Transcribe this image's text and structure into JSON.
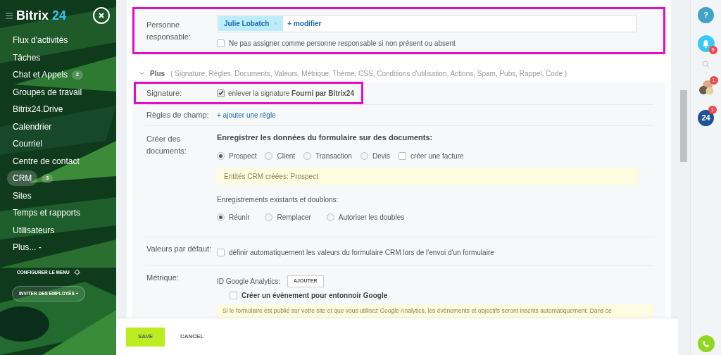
{
  "sidebar": {
    "logo": {
      "name": "Bitrix",
      "number": "24"
    },
    "items": [
      {
        "label": "Flux d'activités",
        "selected": false
      },
      {
        "label": "Tâches",
        "selected": false
      },
      {
        "label": "Chat et Appels",
        "badge": "2",
        "selected": false
      },
      {
        "label": "Groupes de travail",
        "selected": false
      },
      {
        "label": "Bitrix24.Drive",
        "selected": false
      },
      {
        "label": "Calendrier",
        "selected": false
      },
      {
        "label": "Courriel",
        "selected": false
      },
      {
        "label": "Centre de contact",
        "selected": false
      },
      {
        "label": "CRM",
        "badge": "3",
        "selected": true
      },
      {
        "label": "Sites",
        "selected": false
      },
      {
        "label": "Temps et rapports",
        "selected": false
      },
      {
        "label": "Utilisateurs",
        "selected": false
      },
      {
        "label": "Plus... -",
        "selected": false
      }
    ],
    "configure": "CONFIGURER LE MENU",
    "invite": "INVITER DES EMPLOYÉS +"
  },
  "responsible": {
    "label": "Personne responsable:",
    "person": "Julie Lobatch",
    "remove": "×",
    "change": "+ modifier",
    "checkbox": {
      "label": "Ne pas assigner comme personne responsable si non présent ou absent",
      "checked": false
    }
  },
  "more": {
    "title": "Plus",
    "list": "( Signature, Règles, Documents, Valeurs, Métrique, Thème, CSS, Conditions d'utilisation, Actions, Spam, Pubs, Rappel, Code  )"
  },
  "signature": {
    "label": "Signature:",
    "checked": true,
    "text": "enlever la signature **Fourni par Bitrix24**"
  },
  "rules": {
    "label": "Règles de champ:",
    "link": "+ ajouter une règle"
  },
  "documents": {
    "label": "Créer des documents:",
    "heading": "Enregistrer les données du formulaire sur des documents:",
    "options": [
      {
        "kind": "radio",
        "label": "Prospect",
        "selected": true
      },
      {
        "kind": "radio",
        "label": "Client",
        "selected": false
      },
      {
        "kind": "radio",
        "label": "Transaction",
        "selected": false
      },
      {
        "kind": "radio",
        "label": "Devis",
        "selected": false
      },
      {
        "kind": "checkbox",
        "label": "créer une facture",
        "selected": false
      }
    ],
    "note": "Entités CRM créées: Prospect",
    "duplicates_label": "Enregistrements existants et doublons:",
    "duplicates": [
      {
        "label": "Réunir",
        "selected": true
      },
      {
        "label": "Remplacer",
        "selected": false
      },
      {
        "label": "Autoriser les doubles",
        "selected": false
      }
    ]
  },
  "defaults": {
    "label": "Valeurs par défaut:",
    "checkbox": {
      "label": "définir automatiquement les valeurs du formulaire CRM lors de l'envoi d'un formulaire",
      "checked": false
    }
  },
  "metric": {
    "label": "Métrique:",
    "ga_label": "ID Google Analytics:",
    "add": "AJOUTER",
    "event": {
      "label": "Créer un évènement pour entonnoir Google",
      "checked": false
    },
    "note": "Si le formulaire est publié sur votre site et que vous utilisez Google Analytics, les évènements et objectifs seront inscrits automatiquement. Dans ce"
  },
  "footer": {
    "save": "SAVE",
    "cancel": "CANCEL"
  },
  "right_bar": {
    "help": "?",
    "notifications_badge": "9",
    "chat_badge": "1",
    "b24": "24",
    "b24_badge": "1"
  }
}
